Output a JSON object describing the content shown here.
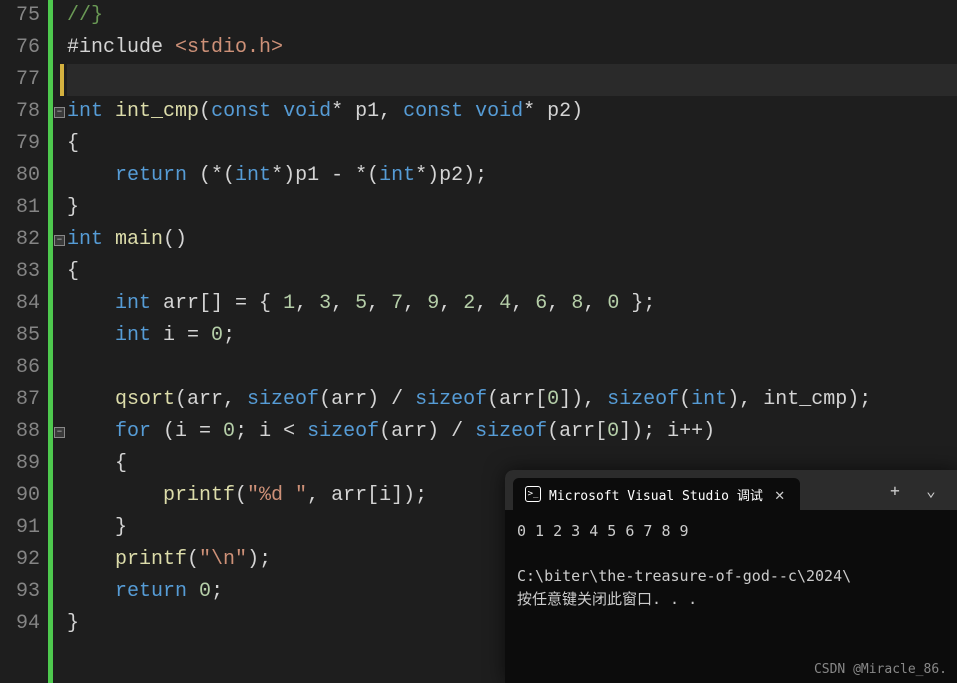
{
  "lines": [
    {
      "num": "75",
      "fold": "",
      "tokens": [
        {
          "t": "//}",
          "c": "green"
        }
      ]
    },
    {
      "num": "76",
      "fold": "",
      "tokens": [
        {
          "t": "#include ",
          "c": "op"
        },
        {
          "t": "<stdio.h>",
          "c": "header"
        }
      ]
    },
    {
      "num": "77",
      "fold": "",
      "current": true,
      "tokens": []
    },
    {
      "num": "78",
      "fold": "⊟",
      "tokens": [
        {
          "t": "int",
          "c": "type"
        },
        {
          "t": " ",
          "c": "op"
        },
        {
          "t": "int_cmp",
          "c": "func"
        },
        {
          "t": "(",
          "c": "paren"
        },
        {
          "t": "const",
          "c": "kw"
        },
        {
          "t": " ",
          "c": "op"
        },
        {
          "t": "void",
          "c": "type"
        },
        {
          "t": "* p1, ",
          "c": "op"
        },
        {
          "t": "const",
          "c": "kw"
        },
        {
          "t": " ",
          "c": "op"
        },
        {
          "t": "void",
          "c": "type"
        },
        {
          "t": "* p2)",
          "c": "op"
        }
      ]
    },
    {
      "num": "79",
      "fold": "",
      "indent": 1,
      "tokens": [
        {
          "t": "{",
          "c": "brace"
        }
      ]
    },
    {
      "num": "80",
      "fold": "",
      "indent": 1,
      "tokens": [
        {
          "t": "    ",
          "c": "op"
        },
        {
          "t": "return",
          "c": "kw"
        },
        {
          "t": " (*(",
          "c": "op"
        },
        {
          "t": "int",
          "c": "type"
        },
        {
          "t": "*)p1 - *(",
          "c": "op"
        },
        {
          "t": "int",
          "c": "type"
        },
        {
          "t": "*)p2);",
          "c": "op"
        }
      ]
    },
    {
      "num": "81",
      "fold": "",
      "indent": 1,
      "tokens": [
        {
          "t": "}",
          "c": "brace"
        }
      ]
    },
    {
      "num": "82",
      "fold": "⊟",
      "tokens": [
        {
          "t": "int",
          "c": "type"
        },
        {
          "t": " ",
          "c": "op"
        },
        {
          "t": "main",
          "c": "func"
        },
        {
          "t": "()",
          "c": "paren"
        }
      ]
    },
    {
      "num": "83",
      "fold": "",
      "indent": 1,
      "tokens": [
        {
          "t": "{",
          "c": "brace"
        }
      ]
    },
    {
      "num": "84",
      "fold": "",
      "indent": 1,
      "tokens": [
        {
          "t": "    ",
          "c": "op"
        },
        {
          "t": "int",
          "c": "type"
        },
        {
          "t": " arr[] = { ",
          "c": "op"
        },
        {
          "t": "1",
          "c": "num"
        },
        {
          "t": ", ",
          "c": "op"
        },
        {
          "t": "3",
          "c": "num"
        },
        {
          "t": ", ",
          "c": "op"
        },
        {
          "t": "5",
          "c": "num"
        },
        {
          "t": ", ",
          "c": "op"
        },
        {
          "t": "7",
          "c": "num"
        },
        {
          "t": ", ",
          "c": "op"
        },
        {
          "t": "9",
          "c": "num"
        },
        {
          "t": ", ",
          "c": "op"
        },
        {
          "t": "2",
          "c": "num"
        },
        {
          "t": ", ",
          "c": "op"
        },
        {
          "t": "4",
          "c": "num"
        },
        {
          "t": ", ",
          "c": "op"
        },
        {
          "t": "6",
          "c": "num"
        },
        {
          "t": ", ",
          "c": "op"
        },
        {
          "t": "8",
          "c": "num"
        },
        {
          "t": ", ",
          "c": "op"
        },
        {
          "t": "0",
          "c": "num"
        },
        {
          "t": " };",
          "c": "op"
        }
      ]
    },
    {
      "num": "85",
      "fold": "",
      "indent": 1,
      "tokens": [
        {
          "t": "    ",
          "c": "op"
        },
        {
          "t": "int",
          "c": "type"
        },
        {
          "t": " i = ",
          "c": "op"
        },
        {
          "t": "0",
          "c": "num"
        },
        {
          "t": ";",
          "c": "op"
        }
      ]
    },
    {
      "num": "86",
      "fold": "",
      "indent": 1,
      "tokens": []
    },
    {
      "num": "87",
      "fold": "",
      "indent": 1,
      "tokens": [
        {
          "t": "    ",
          "c": "op"
        },
        {
          "t": "qsort",
          "c": "func"
        },
        {
          "t": "(arr, ",
          "c": "op"
        },
        {
          "t": "sizeof",
          "c": "kw"
        },
        {
          "t": "(arr) / ",
          "c": "op"
        },
        {
          "t": "sizeof",
          "c": "kw"
        },
        {
          "t": "(arr[",
          "c": "op"
        },
        {
          "t": "0",
          "c": "num"
        },
        {
          "t": "]), ",
          "c": "op"
        },
        {
          "t": "sizeof",
          "c": "kw"
        },
        {
          "t": "(",
          "c": "op"
        },
        {
          "t": "int",
          "c": "type"
        },
        {
          "t": "), int_cmp);",
          "c": "op"
        }
      ]
    },
    {
      "num": "88",
      "fold": "⊟",
      "indent": 1,
      "tokens": [
        {
          "t": "    ",
          "c": "op"
        },
        {
          "t": "for",
          "c": "kw"
        },
        {
          "t": " (i = ",
          "c": "op"
        },
        {
          "t": "0",
          "c": "num"
        },
        {
          "t": "; i < ",
          "c": "op"
        },
        {
          "t": "sizeof",
          "c": "kw"
        },
        {
          "t": "(arr) / ",
          "c": "op"
        },
        {
          "t": "sizeof",
          "c": "kw"
        },
        {
          "t": "(arr[",
          "c": "op"
        },
        {
          "t": "0",
          "c": "num"
        },
        {
          "t": "]); i++)",
          "c": "op"
        }
      ]
    },
    {
      "num": "89",
      "fold": "",
      "indent": 2,
      "tokens": [
        {
          "t": "    {",
          "c": "brace"
        }
      ]
    },
    {
      "num": "90",
      "fold": "",
      "indent": 2,
      "tokens": [
        {
          "t": "        ",
          "c": "op"
        },
        {
          "t": "printf",
          "c": "func"
        },
        {
          "t": "(",
          "c": "op"
        },
        {
          "t": "\"%d \"",
          "c": "str"
        },
        {
          "t": ", arr[i]);",
          "c": "op"
        }
      ]
    },
    {
      "num": "91",
      "fold": "",
      "indent": 2,
      "tokens": [
        {
          "t": "    }",
          "c": "brace"
        }
      ]
    },
    {
      "num": "92",
      "fold": "",
      "indent": 1,
      "tokens": [
        {
          "t": "    ",
          "c": "op"
        },
        {
          "t": "printf",
          "c": "func"
        },
        {
          "t": "(",
          "c": "op"
        },
        {
          "t": "\"\\n\"",
          "c": "str"
        },
        {
          "t": ");",
          "c": "op"
        }
      ]
    },
    {
      "num": "93",
      "fold": "",
      "indent": 1,
      "tokens": [
        {
          "t": "    ",
          "c": "op"
        },
        {
          "t": "return",
          "c": "kw"
        },
        {
          "t": " ",
          "c": "op"
        },
        {
          "t": "0",
          "c": "num"
        },
        {
          "t": ";",
          "c": "op"
        }
      ]
    },
    {
      "num": "94",
      "fold": "",
      "indent": 1,
      "tokens": [
        {
          "t": "}",
          "c": "brace"
        }
      ]
    }
  ],
  "terminal": {
    "tab_title": "Microsoft Visual Studio 调试",
    "output_line1": "0 1 2 3 4 5 6 7 8 9",
    "output_line2": "C:\\biter\\the-treasure-of-god--c\\2024\\",
    "output_line3": "按任意键关闭此窗口. . .",
    "add_label": "+",
    "dropdown_label": "⌄"
  },
  "watermark": "CSDN @Miracle_86."
}
